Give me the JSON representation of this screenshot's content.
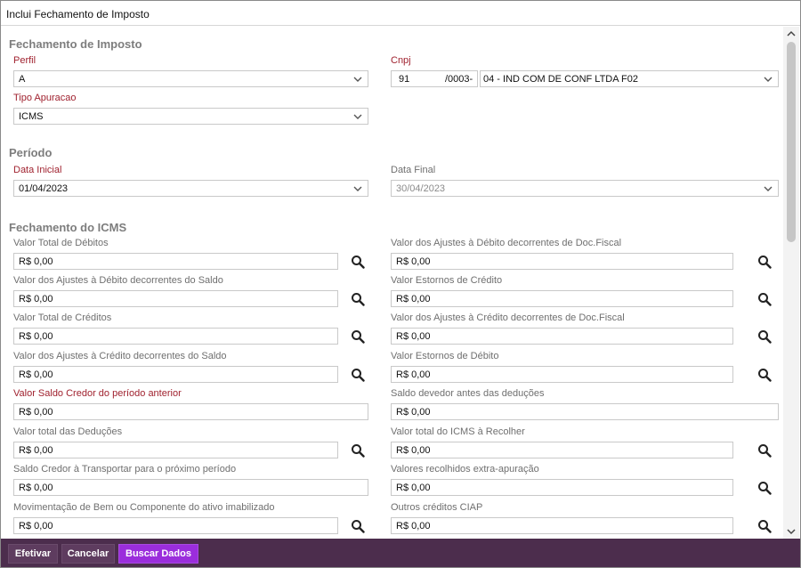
{
  "window": {
    "title": "Inclui Fechamento de Imposto"
  },
  "sections": {
    "fechamento": "Fechamento de Imposto",
    "periodo": "Período",
    "icms": "Fechamento do ICMS"
  },
  "perfil": {
    "label": "Perfil",
    "value": "A"
  },
  "cnpj": {
    "label": "Cnpj",
    "part1": "91",
    "part2": "/0003-",
    "company": "04 -  IND COM DE CONF LTDA F02"
  },
  "tipo_apuracao": {
    "label": "Tipo Apuracao",
    "value": "ICMS"
  },
  "data_inicial": {
    "label": "Data Inicial",
    "value": "01/04/2023"
  },
  "data_final": {
    "label": "Data Final",
    "value": "30/04/2023"
  },
  "icms_fields": [
    {
      "label": "Valor Total de Débitos",
      "value": "R$ 0,00"
    },
    {
      "label": "Valor dos Ajustes à Débito decorrentes de Doc.Fiscal",
      "value": "R$ 0,00"
    },
    {
      "label": "Valor dos Ajustes à Débito decorrentes do Saldo",
      "value": "R$ 0,00"
    },
    {
      "label": "Valor Estornos de Crédito",
      "value": "R$ 0,00"
    },
    {
      "label": "Valor Total de Créditos",
      "value": "R$ 0,00"
    },
    {
      "label": "Valor dos Ajustes à Crédito decorrentes de Doc.Fiscal",
      "value": "R$ 0,00"
    },
    {
      "label": "Valor dos Ajustes à Crédito decorrentes do Saldo",
      "value": "R$ 0,00"
    },
    {
      "label": "Valor Estornos de Débito",
      "value": "R$ 0,00"
    },
    {
      "label": "Valor Saldo Credor do período anterior",
      "value": "R$ 0,00"
    },
    {
      "label": "Saldo devedor antes das deduções",
      "value": "R$ 0,00"
    },
    {
      "label": "Valor total das Deduções",
      "value": "R$ 0,00"
    },
    {
      "label": "Valor total do ICMS à Recolher",
      "value": "R$ 0,00"
    },
    {
      "label": "Saldo Credor à Transportar para o próximo período",
      "value": "R$ 0,00"
    },
    {
      "label": "Valores recolhidos extra-apuração",
      "value": "R$ 0,00"
    },
    {
      "label": "Movimentação de Bem ou Componente do ativo imabilizado",
      "value": "R$ 0,00"
    },
    {
      "label": "Outros créditos CIAP",
      "value": "R$ 0,00"
    }
  ],
  "footer": {
    "efetivar": "Efetivar",
    "cancelar": "Cancelar",
    "buscar": "Buscar Dados"
  },
  "colors": {
    "footer_bg": "#4c2d4d",
    "primary_button": "#9b2ddc",
    "required_label": "#a0222f"
  },
  "icons": {
    "search": "magnifier-icon",
    "dropdown": "chevron-down-icon"
  }
}
